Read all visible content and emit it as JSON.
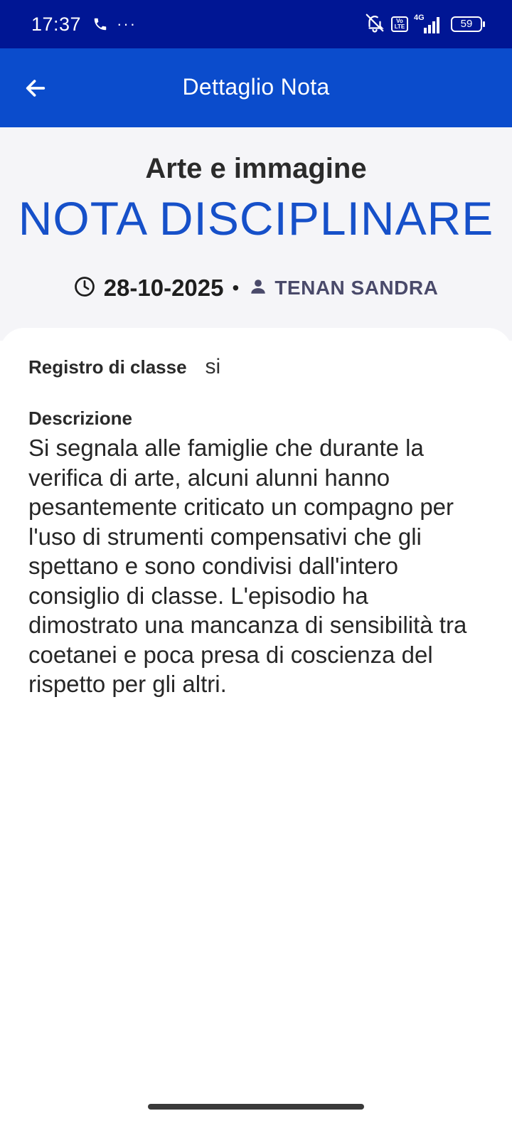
{
  "status_bar": {
    "time": "17:37",
    "dots": "···",
    "volte_label": "Vo LTE",
    "network_label": "4G",
    "battery": "59",
    "icons": [
      "phone-icon",
      "bell-off-icon",
      "volte-icon",
      "signal-icon",
      "battery-icon"
    ]
  },
  "app_bar": {
    "title": "Dettaglio Nota"
  },
  "header": {
    "subject": "Arte e immagine",
    "note_type": "NOTA DISCIPLINARE",
    "date": "28-10-2025",
    "separator": "•",
    "teacher": "TENAN SANDRA"
  },
  "details": {
    "registro_label": "Registro di classe",
    "registro_value": "si",
    "descrizione_label": "Descrizione",
    "descrizione_text": "Si segnala alle famiglie che durante la verifica di arte, alcuni alunni hanno pesantemente criticato un compagno per l'uso di strumenti compensativi che gli spettano e sono condivisi dall'intero consiglio di classe. L'episodio ha dimostrato una mancanza di sensibilità tra coetanei e poca presa di coscienza del rispetto per gli altri."
  },
  "colors": {
    "status_bar": "#001694",
    "app_bar": "#0b4ccc",
    "accent": "#1650c9",
    "header_bg": "#f5f5f8"
  }
}
